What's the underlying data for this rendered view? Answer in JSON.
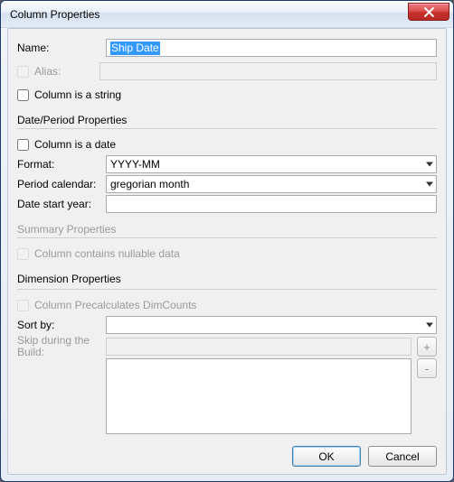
{
  "window": {
    "title": "Column Properties"
  },
  "labels": {
    "name": "Name:",
    "alias": "Alias:",
    "colString": "Column is a string",
    "dateSection": "Date/Period Properties",
    "colDate": "Column is a date",
    "format": "Format:",
    "periodCal": "Period calendar:",
    "startYear": "Date start year:",
    "summarySection": "Summary Properties",
    "nullable": "Column contains nullable data",
    "dimSection": "Dimension Properties",
    "precalc": "Column Precalculates DimCounts",
    "sortBy": "Sort by:",
    "skipBuild": "Skip during the Build:",
    "add": "+",
    "remove": "-",
    "ok": "OK",
    "cancel": "Cancel"
  },
  "values": {
    "name": "Ship Date",
    "alias": "",
    "format": "YYYY-MM",
    "periodCal": "gregorian month",
    "startYear": "",
    "sortBy": "",
    "skipBuild": "",
    "skipList": ""
  }
}
